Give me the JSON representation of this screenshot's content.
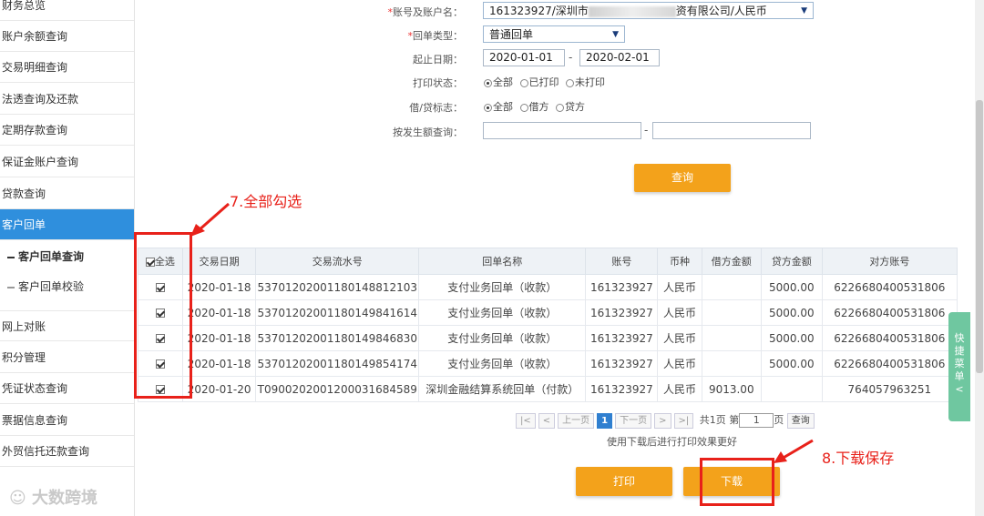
{
  "sidebar": {
    "items": [
      {
        "label": "财务总览"
      },
      {
        "label": "账户余额查询"
      },
      {
        "label": "交易明细查询"
      },
      {
        "label": "法透查询及还款"
      },
      {
        "label": "定期存款查询"
      },
      {
        "label": "保证金账户查询"
      },
      {
        "label": "贷款查询"
      },
      {
        "label": "客户回单"
      },
      {
        "label": "网上对账"
      },
      {
        "label": "积分管理"
      },
      {
        "label": "凭证状态查询"
      },
      {
        "label": "票据信息查询"
      },
      {
        "label": "外贸信托还款查询"
      }
    ],
    "subitems": [
      {
        "label": "客户回单查询"
      },
      {
        "label": "客户回单校验"
      }
    ]
  },
  "form": {
    "account_label": "账号及账户名：",
    "account_value_prefix": "161323927/深圳市",
    "account_value_suffix": "资有限公司/人民币",
    "receipt_type_label": "回单类型：",
    "receipt_type_value": "普通回单",
    "date_label": "起止日期：",
    "date_from": "2020-01-01",
    "date_to": "2020-02-01",
    "print_status_label": "打印状态：",
    "print_status_options": [
      "全部",
      "已打印",
      "未打印"
    ],
    "debit_credit_label": "借/贷标志：",
    "debit_credit_options": [
      "全部",
      "借方",
      "贷方"
    ],
    "amount_label": "按发生额查询：",
    "query_button": "查询"
  },
  "annotations": {
    "step7": "7.全部勾选",
    "step8": "8.下载保存"
  },
  "table": {
    "select_all": "全选",
    "headers": [
      "交易日期",
      "交易流水号",
      "回单名称",
      "账号",
      "币种",
      "借方金额",
      "贷方金额",
      "对方账号"
    ],
    "rows": [
      {
        "date": "2020-01-18",
        "serial": "53701202001180148812103",
        "name": "支付业务回单（收款）",
        "account": "161323927",
        "currency": "人民币",
        "debit": "",
        "credit": "5000.00",
        "counter": "6226680400531806"
      },
      {
        "date": "2020-01-18",
        "serial": "53701202001180149841614",
        "name": "支付业务回单（收款）",
        "account": "161323927",
        "currency": "人民币",
        "debit": "",
        "credit": "5000.00",
        "counter": "6226680400531806"
      },
      {
        "date": "2020-01-18",
        "serial": "53701202001180149846830",
        "name": "支付业务回单（收款）",
        "account": "161323927",
        "currency": "人民币",
        "debit": "",
        "credit": "5000.00",
        "counter": "6226680400531806"
      },
      {
        "date": "2020-01-18",
        "serial": "53701202001180149854174",
        "name": "支付业务回单（收款）",
        "account": "161323927",
        "currency": "人民币",
        "debit": "",
        "credit": "5000.00",
        "counter": "6226680400531806"
      },
      {
        "date": "2020-01-20",
        "serial": "T09002020012000316845​89",
        "name": "深圳金融结算系统回单（付款）",
        "account": "161323927",
        "currency": "人民币",
        "debit": "9013.00",
        "credit": "",
        "counter": "764057963251"
      }
    ]
  },
  "pager": {
    "first": "|<",
    "prev_arrow": "<",
    "prev": "上一页",
    "current": "1",
    "next": "下一页",
    "next_arrow": ">",
    "last": ">|",
    "total_prefix": "共1页 第",
    "page_input": "1",
    "page_suffix": "页",
    "go": "查询",
    "note": "使用下载后进行打印效果更好"
  },
  "actions": {
    "print": "打印",
    "download": "下载"
  },
  "float_tab": "快捷菜单<",
  "watermark": "大数跨境"
}
